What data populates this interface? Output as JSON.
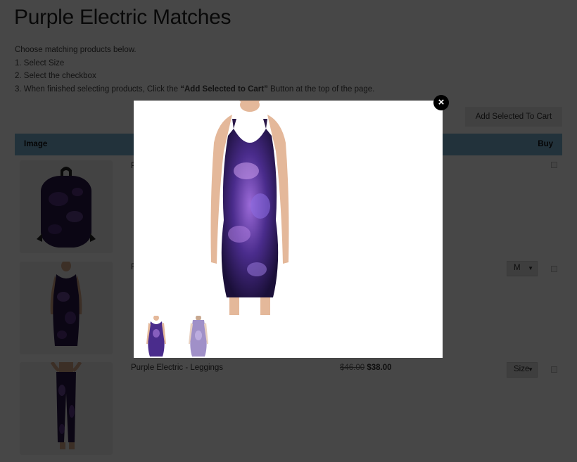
{
  "page": {
    "title": "Purple Electric Matches",
    "intro": {
      "line1": "Choose matching products below.",
      "step1": "1. Select Size",
      "step2": "2. Select the checkbox",
      "step3_before": "3. When finished selecting products, Click the ",
      "step3_bold": "“Add Selected to Cart”",
      "step3_after": " Button at the top of the page."
    },
    "add_selected_label": "Add Selected To Cart"
  },
  "table": {
    "headers": {
      "image": "Image",
      "buy": "Buy"
    },
    "rows": [
      {
        "image_icon": "backpack-image",
        "name": "Purple Electric - Backpack",
        "size": null,
        "checked": false
      },
      {
        "image_icon": "dress-image",
        "name": "Purple Electric - Dress",
        "size": "M",
        "checked": false
      },
      {
        "image_icon": "leggings-image",
        "name": "Purple Electric - Leggings",
        "old_price": "$46.00",
        "price": "$38.00",
        "size": "Size",
        "checked": false
      }
    ]
  },
  "modal": {
    "close_label": "×",
    "main_image": "dress-front-image",
    "thumbnails": [
      "dress-front-thumbnail",
      "dress-back-thumbnail"
    ]
  },
  "colors": {
    "header_bg": "#7cb2d4",
    "dress_purple": "#4a2c8c"
  }
}
